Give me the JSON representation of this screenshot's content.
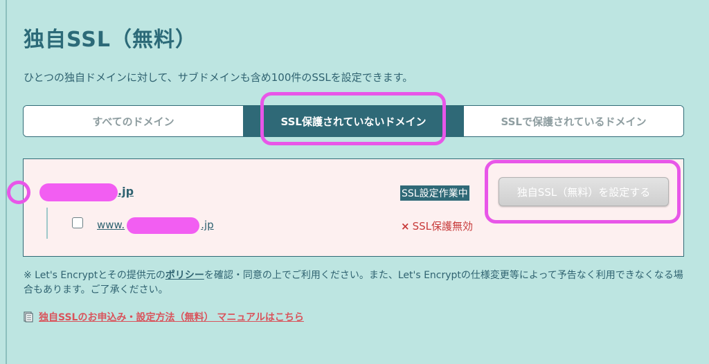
{
  "page": {
    "title": "独自SSL（無料）",
    "description": "ひとつの独自ドメインに対して、サブドメインも含め100件のSSLを設定できます。"
  },
  "tabs": [
    {
      "label": "すべてのドメイン",
      "active": false
    },
    {
      "label": "SSL保護されていないドメイン",
      "active": true
    },
    {
      "label": "SSLで保護されているドメイン",
      "active": false
    }
  ],
  "domains": {
    "main_suffix": ".jp",
    "status_working": "SSL設定作業中",
    "set_button_label": "独自SSL（無料）を設定する",
    "sub": {
      "prefix": "www.",
      "suffix": ".jp",
      "status": "SSL保護無効",
      "status_mark": "×"
    }
  },
  "note": {
    "part1": "※ Let's Encryptとその提供元の",
    "policy_link": "ポリシー",
    "part2": "を確認・同意の上でご利用ください。また、Let's Encryptの仕様変更等によって予告なく利用できなくなる場合もあります。ご了承ください。"
  },
  "manual_link": {
    "label": "独自SSLのお申込み・設定方法（無料） マニュアルはこちら",
    "icon": "document-icon"
  },
  "colors": {
    "background": "#bde5e1",
    "accent": "#2f6977",
    "highlight": "#e856e8",
    "panel": "#fdf0f0",
    "error": "#c73a3a",
    "link": "#d9535b"
  }
}
